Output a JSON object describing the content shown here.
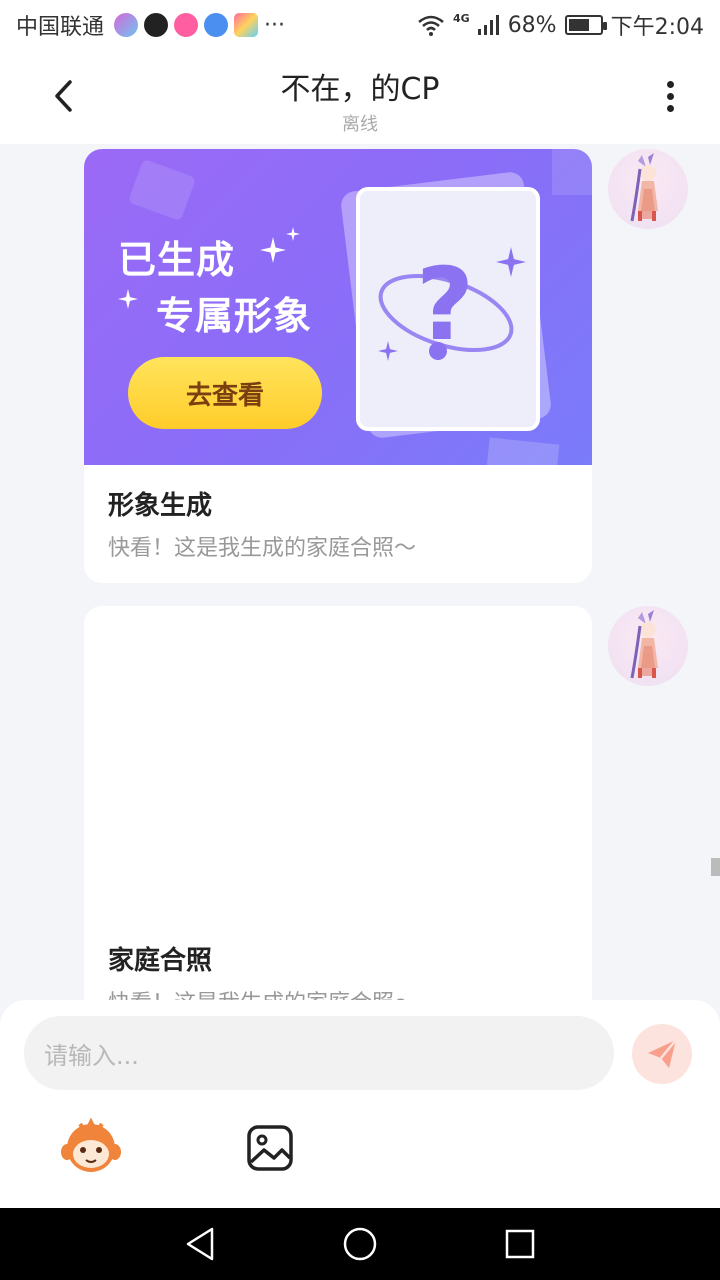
{
  "status": {
    "carrier": "中国联通",
    "more": "···",
    "network": "4G",
    "battery_percent": 68,
    "battery_label": "68%",
    "time": "下午2:04"
  },
  "header": {
    "title": "不在，的CP",
    "subtitle": "离线"
  },
  "messages": [
    {
      "banner_line1": "已生成",
      "banner_line2": "专属形象",
      "banner_button": "去查看",
      "title": "形象生成",
      "desc": "快看！这是我生成的家庭合照～"
    },
    {
      "title": "家庭合照",
      "desc": "快看！这是我生成的家庭合照～"
    }
  ],
  "input": {
    "placeholder": "请输入..."
  },
  "colors": {
    "banner_start": "#9b6af6",
    "banner_end": "#7a7cfa",
    "button_yellow": "#ffcc2a",
    "send_bg": "#fde3de",
    "send_icon": "#f8a08c"
  }
}
